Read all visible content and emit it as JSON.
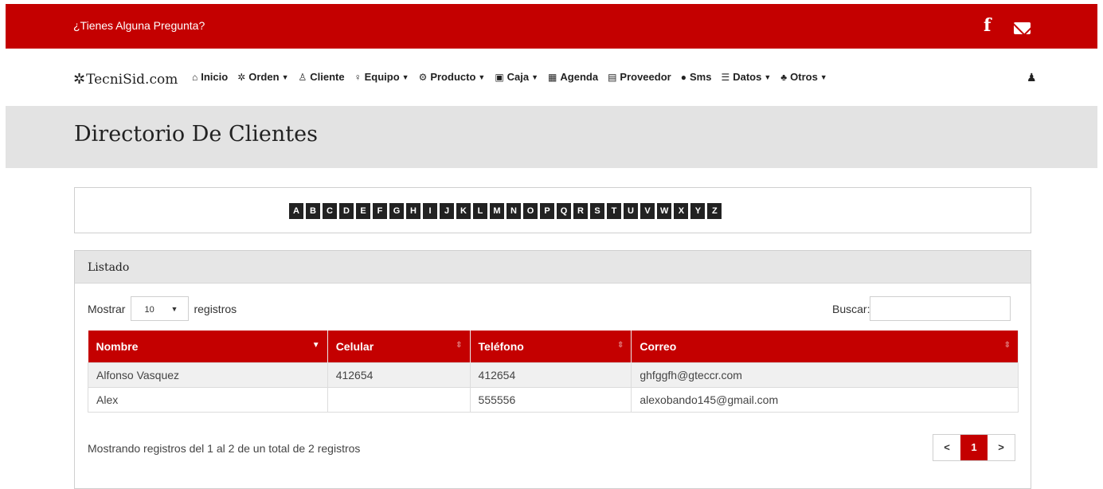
{
  "topbar": {
    "question": "¿Tienes Alguna Pregunta?",
    "facebook_glyph": "f"
  },
  "navbar": {
    "brand": "TecniSid.com",
    "items": [
      {
        "label": "Inicio",
        "icon": "home-icon",
        "glyph": "⌂",
        "caret": false
      },
      {
        "label": "Orden",
        "icon": "gear-icon",
        "glyph": "✲",
        "caret": true
      },
      {
        "label": "Cliente",
        "icon": "person-icon",
        "glyph": "♙",
        "caret": false
      },
      {
        "label": "Equipo",
        "icon": "lightbulb-icon",
        "glyph": "♀",
        "caret": true
      },
      {
        "label": "Producto",
        "icon": "cogs-icon",
        "glyph": "⚙",
        "caret": true
      },
      {
        "label": "Caja",
        "icon": "cash-icon",
        "glyph": "▣",
        "caret": true
      },
      {
        "label": "Agenda",
        "icon": "calendar-icon",
        "glyph": "▦",
        "caret": false
      },
      {
        "label": "Proveedor",
        "icon": "book-icon",
        "glyph": "▤",
        "caret": false
      },
      {
        "label": "Sms",
        "icon": "chat-icon",
        "glyph": "●",
        "caret": false
      },
      {
        "label": "Datos",
        "icon": "list-icon",
        "glyph": "☰",
        "caret": true
      },
      {
        "label": "Otros",
        "icon": "sitemap-icon",
        "glyph": "♣",
        "caret": true
      }
    ]
  },
  "page": {
    "title": "Directorio De Clientes"
  },
  "alphabet": [
    "A",
    "B",
    "C",
    "D",
    "E",
    "F",
    "G",
    "H",
    "I",
    "J",
    "K",
    "L",
    "M",
    "N",
    "O",
    "P",
    "Q",
    "R",
    "S",
    "T",
    "U",
    "V",
    "W",
    "X",
    "Y",
    "Z"
  ],
  "panel": {
    "title": "Listado",
    "show_label": "Mostrar",
    "show_value": "10",
    "records_label": "registros",
    "search_label": "Buscar:",
    "search_value": "",
    "columns": [
      "Nombre",
      "Celular",
      "Teléfono",
      "Correo"
    ],
    "rows": [
      [
        "Alfonso Vasquez",
        "412654",
        "412654",
        "ghfggfh@gteccr.com"
      ],
      [
        "Alex",
        "",
        "555556",
        "alexobando145@gmail.com"
      ]
    ],
    "info": "Mostrando registros del 1 al 2 de un total de 2 registros",
    "pager": {
      "prev": "<",
      "current": "1",
      "next": ">"
    }
  },
  "colors": {
    "brand_red": "#c40000",
    "band_gray": "#e3e3e3"
  }
}
